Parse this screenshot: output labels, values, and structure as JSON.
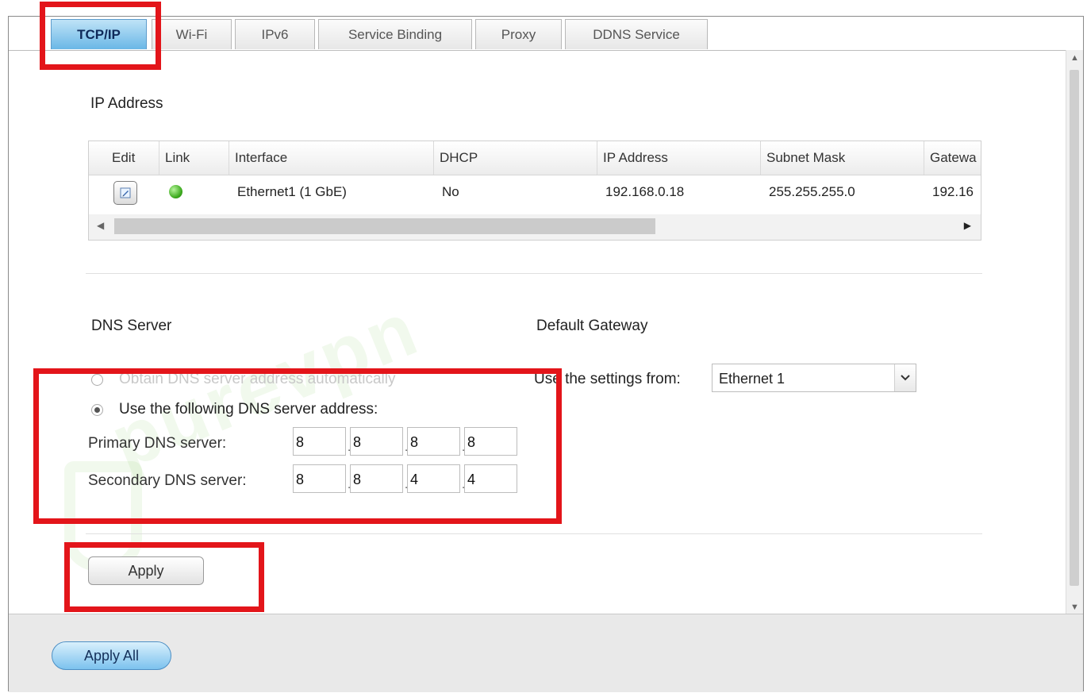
{
  "tabs": [
    {
      "label": "TCP/IP",
      "active": true
    },
    {
      "label": "Wi-Fi",
      "active": false
    },
    {
      "label": "IPv6",
      "active": false
    },
    {
      "label": "Service Binding",
      "active": false
    },
    {
      "label": "Proxy",
      "active": false
    },
    {
      "label": "DDNS Service",
      "active": false
    }
  ],
  "ip_section": {
    "title": "IP Address",
    "columns": [
      "Edit",
      "Link",
      "Interface",
      "DHCP",
      "IP Address",
      "Subnet Mask",
      "Gatewa"
    ],
    "rows": [
      {
        "interface": "Ethernet1 (1 GbE)",
        "dhcp": "No",
        "ip": "192.168.0.18",
        "mask": "255.255.255.0",
        "gateway": "192.16"
      }
    ],
    "icons": {
      "edit": "pencil-edit-icon",
      "link": "green-status-dot-icon"
    }
  },
  "dns": {
    "title": "DNS Server",
    "option_auto": "Obtain DNS server address automatically",
    "option_manual": "Use the following DNS server address:",
    "selected": "manual",
    "primary_label": "Primary DNS server:",
    "secondary_label": "Secondary DNS server:",
    "primary": [
      "8",
      "8",
      "8",
      "8"
    ],
    "secondary": [
      "8",
      "8",
      "4",
      "4"
    ]
  },
  "gateway": {
    "title": "Default Gateway",
    "label": "Use the settings from:",
    "selected": "Ethernet 1"
  },
  "buttons": {
    "apply": "Apply",
    "apply_all": "Apply All"
  },
  "watermark": "purevpn",
  "colors": {
    "highlight": "#e3151a",
    "tab_active": "#6ab7e6",
    "link_status": "#3aa81c"
  }
}
